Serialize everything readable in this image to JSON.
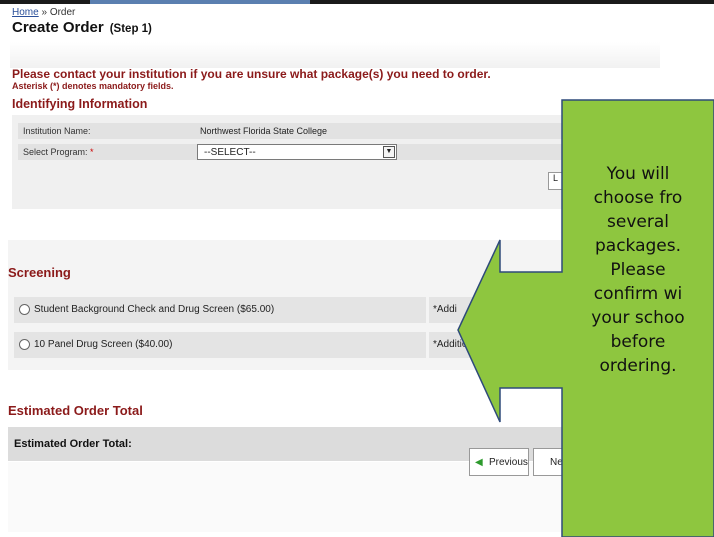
{
  "breadcrumb": {
    "home": "Home",
    "sep": "»",
    "current": "Order"
  },
  "page": {
    "title": "Create Order",
    "step": "(Step 1)"
  },
  "notice": {
    "contact": "Please contact your institution if you are unsure what package(s) you need to order.",
    "asterisk": "Asterisk (*) denotes mandatory fields."
  },
  "identifying": {
    "heading": "Identifying Information",
    "institution_label": "Institution Name:",
    "institution_value": "Northwest Florida State College",
    "program_label": "Select Program:",
    "required_mark": "*",
    "program_selected": "--SELECT--",
    "stub_button": "L"
  },
  "screening": {
    "heading": "Screening",
    "options": [
      {
        "label": "Student Background Check and Drug Screen ($65.00)",
        "note": "*Addi"
      },
      {
        "label": "10 Panel Drug Screen ($40.00)",
        "note": "*Additional fe"
      }
    ]
  },
  "estimate": {
    "heading": "Estimated Order Total",
    "label": "Estimated Order Total:"
  },
  "buttons": {
    "previous": "Previous",
    "next": "Ne"
  },
  "callout": {
    "lines": [
      "You will",
      "choose fro",
      "several",
      "packages.",
      "Please",
      "confirm wi",
      "your schoo",
      "before",
      "ordering."
    ],
    "fill_color": "#8ec63f",
    "stroke_color": "#2e4a7a"
  },
  "colors": {
    "heading": "#8b1a1a",
    "link": "#2a4f9a"
  }
}
